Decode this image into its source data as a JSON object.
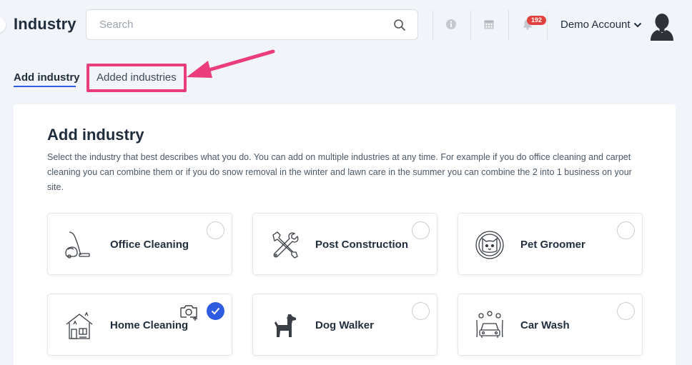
{
  "header": {
    "title": "Industry",
    "search_placeholder": "Search",
    "notification_count": "192",
    "account_label": "Demo Account"
  },
  "tabs": [
    {
      "label": "Add industry",
      "active": true
    },
    {
      "label": "Added industries",
      "active": false
    }
  ],
  "section": {
    "title": "Add industry",
    "description": "Select the industry that best describes what you do. You can add on multiple industries at any time. For example if you do office cleaning and carpet cleaning you can combine them or if you do snow removal in the winter and lawn care in the summer you can combine the 2 into 1 business on your site."
  },
  "industries": [
    {
      "label": "Office Cleaning",
      "icon": "vacuum-icon",
      "selected": false
    },
    {
      "label": "Post Construction",
      "icon": "tools-icon",
      "selected": false
    },
    {
      "label": "Pet Groomer",
      "icon": "cat-icon",
      "selected": false
    },
    {
      "label": "Home Cleaning",
      "icon": "house-icon",
      "selected": true
    },
    {
      "label": "Dog Walker",
      "icon": "dog-icon",
      "selected": false
    },
    {
      "label": "Car Wash",
      "icon": "car-wash-icon",
      "selected": false
    }
  ],
  "colors": {
    "accent": "#2e5be0",
    "highlight": "#ea3d7a",
    "badge": "#e0413e",
    "background": "#f1f4f8"
  }
}
